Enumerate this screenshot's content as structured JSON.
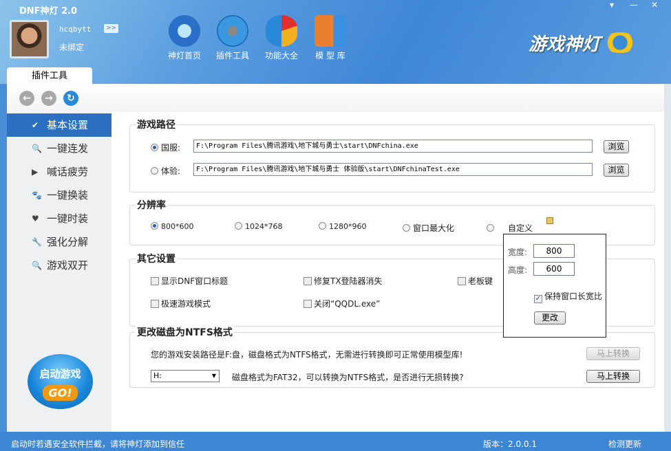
{
  "window": {
    "title": "DNF神灯  2.0",
    "controls": [
      "▾",
      "—",
      "✕"
    ]
  },
  "user": {
    "name": "hcqbytt",
    "bind_status": "未绑定",
    "more": ">>"
  },
  "nav": [
    {
      "label": "神灯首页",
      "icon": "star-icon"
    },
    {
      "label": "插件工具",
      "icon": "gear-icon"
    },
    {
      "label": "功能大全",
      "icon": "pie-icon"
    },
    {
      "label": "模 型 库",
      "icon": "model-icon"
    }
  ],
  "logo": "游戏神灯",
  "tab": "插件工具",
  "toolbar": {
    "back": "←",
    "forward": "→",
    "refresh": "↻"
  },
  "sidebar": {
    "items": [
      {
        "label": "基本设置",
        "icon": "✔"
      },
      {
        "label": "一键连发",
        "icon": "🔍"
      },
      {
        "label": "喊话疲劳",
        "icon": "▶"
      },
      {
        "label": "一键换装",
        "icon": "🐾"
      },
      {
        "label": "一键时装",
        "icon": "♥"
      },
      {
        "label": "强化分解",
        "icon": "🔧"
      },
      {
        "label": "游戏双开",
        "icon": "🔍"
      }
    ],
    "start_game": "启动游戏",
    "go": "GO!"
  },
  "game_path": {
    "title": "游戏路径",
    "rows": [
      {
        "label": "国服:",
        "path": "F:\\Program Files\\腾讯游戏\\地下城与勇士\\start\\DNFchina.exe",
        "browse": "浏览",
        "selected": true
      },
      {
        "label": "体验:",
        "path": "F:\\Program Files\\腾讯游戏\\地下城与勇士 体验版\\start\\DNFchinaTest.exe",
        "browse": "浏览",
        "selected": false
      }
    ]
  },
  "resolution": {
    "title": "分辨率",
    "options": [
      {
        "label": "800*600",
        "selected": true
      },
      {
        "label": "1024*768",
        "selected": false
      },
      {
        "label": "1280*960",
        "selected": false
      },
      {
        "label": "窗口最大化",
        "selected": false
      },
      {
        "label": "自定义",
        "selected": false
      }
    ]
  },
  "other": {
    "title": "其它设置",
    "items": [
      {
        "label": "显示DNF窗口标题",
        "checked": false
      },
      {
        "label": "修复TX登陆器消失",
        "checked": false
      },
      {
        "label": "老板键",
        "checked": false
      },
      {
        "label": "极速游戏模式",
        "checked": false
      },
      {
        "label": "关闭“QQDL.exe”",
        "checked": false
      }
    ]
  },
  "custom_popup": {
    "width_label": "宽度:",
    "width": "800",
    "height_label": "高度:",
    "height": "600",
    "keep_ratio": "保持窗口长宽比",
    "keep_ratio_checked": true,
    "apply": "更改"
  },
  "ntfs": {
    "title": "更改磁盘为NTFS格式",
    "msg1": "您的游戏安装路径是F:盘，磁盘格式为NTFS格式，无需进行转换即可正常使用模型库!",
    "btn1": "马上转换",
    "drive": "H:",
    "msg2": "磁盘格式为FAT32，可以转换为NTFS格式，是否进行无损转换?",
    "btn2": "马上转换"
  },
  "status": {
    "tip": "启动时若遇安全软件拦截，请将神灯添加到信任",
    "version": "版本：2.0.0.1",
    "update": "检测更新"
  }
}
